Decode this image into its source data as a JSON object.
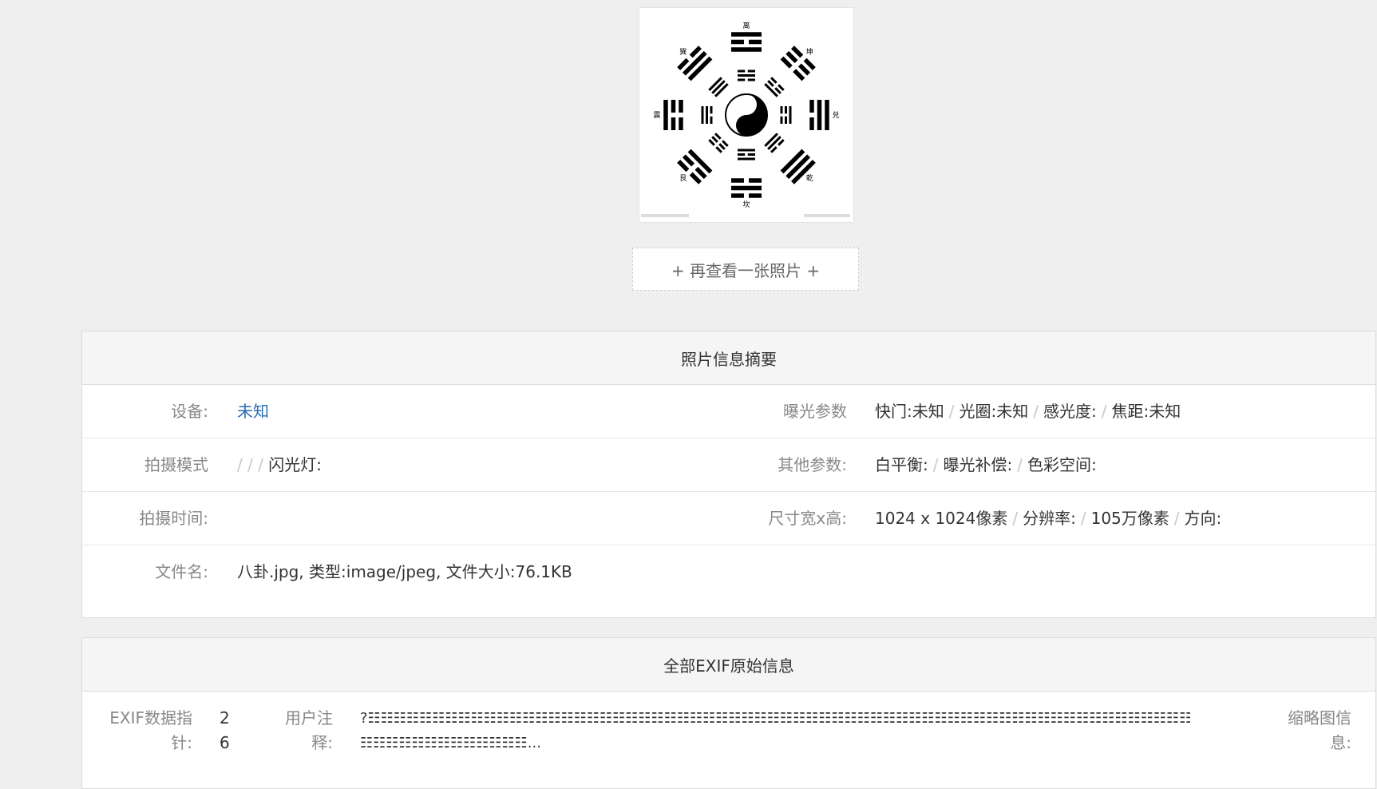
{
  "photo": {
    "image_name": "八卦.jpg",
    "trigrams": [
      "离",
      "坤",
      "兑",
      "乾",
      "坎",
      "艮",
      "震",
      "巽"
    ]
  },
  "more_button": {
    "label": "+ 再查看一张照片 +"
  },
  "summary": {
    "heading": "照片信息摘要",
    "device_label": "设备:",
    "device_value": "未知",
    "exposure_label": "曝光参数",
    "shutter": "快门:未知",
    "aperture": "光圈:未知",
    "iso": "感光度:",
    "focal": "焦距:未知",
    "mode_label": "拍摄模式",
    "mode_seps": "/ / /",
    "flash": "闪光灯:",
    "other_label": "其他参数:",
    "white_balance": "白平衡:",
    "exposure_comp": "曝光补偿:",
    "color_space": "色彩空间:",
    "time_label": "拍摄时间:",
    "size_label": "尺寸宽x高:",
    "dimensions": "1024 x 1024像素",
    "resolution": "分辨率:",
    "megapixels": "105万像素",
    "orientation": "方向:",
    "file_label": "文件名:",
    "file_value": "八卦.jpg, 类型:image/jpeg, 文件大小:76.1KB"
  },
  "exif": {
    "heading": "全部EXIF原始信息",
    "pointer_label_1": "EXIF数据指",
    "pointer_label_2": "针:",
    "pointer_value_1": "2",
    "pointer_value_2": "6",
    "comment_label_1": "用户注",
    "comment_label_2": "释:",
    "comment_value_1": "?☷☷☷☷☷☷☷☷☷☷☷☷☷☷☷☷☷☷☷☷☷☷☷☷☷☷☷☷☷☷☷☷☷☷☷☷☷☷☷☷☷☷☷☷☷☷☷☷☷☷☷☷☷☷☷☷☷☷☷☷☷☷☷☷☷☷☷☷",
    "comment_value_2": "☷☷☷☷☷☷☷☷☷☷☷☷☷...",
    "thumb_label_1": "缩略图信",
    "thumb_label_2": "息:"
  }
}
